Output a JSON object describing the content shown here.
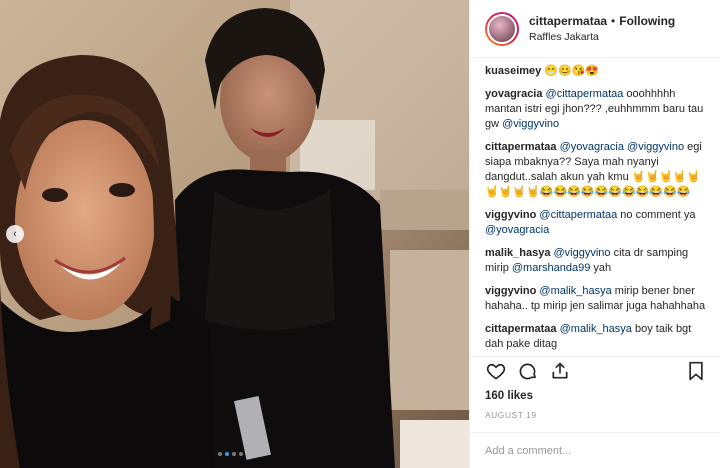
{
  "header": {
    "username": "cittapermataa",
    "separator": "•",
    "follow_status": "Following",
    "location": "Raffles Jakarta"
  },
  "comments": [
    {
      "user": "kuaseimey",
      "parts": [
        {
          "t": "text",
          "v": " 😁😊😘😍"
        }
      ]
    },
    {
      "user": "yovagracia",
      "parts": [
        {
          "t": "mention",
          "v": "@cittapermataa"
        },
        {
          "t": "text",
          "v": " ooohhhhh mantan istri egi jhon??? ,euhhmmm baru tau gw "
        },
        {
          "t": "mention",
          "v": "@viggyvino"
        }
      ]
    },
    {
      "user": "cittapermataa",
      "parts": [
        {
          "t": "mention",
          "v": "@yovagracia"
        },
        {
          "t": "text",
          "v": " "
        },
        {
          "t": "mention",
          "v": "@viggyvino"
        },
        {
          "t": "text",
          "v": " egi siapa mbaknya?? Saya mah nyanyi dangdut..salah akun yah kmu 🤘🤘🤘🤘🤘🤘🤘🤘🤘😂😂😂😂😂😂😂😂😂😂😂"
        }
      ]
    },
    {
      "user": "viggyvino",
      "parts": [
        {
          "t": "mention",
          "v": "@cittapermataa"
        },
        {
          "t": "text",
          "v": " no comment ya "
        },
        {
          "t": "mention",
          "v": "@yovagracia"
        }
      ]
    },
    {
      "user": "malik_hasya",
      "parts": [
        {
          "t": "mention",
          "v": "@viggyvino"
        },
        {
          "t": "text",
          "v": " cita dr samping mirip "
        },
        {
          "t": "mention",
          "v": "@marshanda99"
        },
        {
          "t": "text",
          "v": " yah"
        }
      ]
    },
    {
      "user": "viggyvino",
      "parts": [
        {
          "t": "mention",
          "v": "@malik_hasya"
        },
        {
          "t": "text",
          "v": " mirip bener bner hahaha.. tp mirip jen salimar juga hahahhaha"
        }
      ]
    },
    {
      "user": "cittapermataa",
      "parts": [
        {
          "t": "mention",
          "v": "@malik_hasya"
        },
        {
          "t": "text",
          "v": " boy taik bgt dah pake ditag"
        }
      ]
    }
  ],
  "actions": {
    "like_icon": "heart-icon",
    "comment_icon": "comment-icon",
    "share_icon": "share-icon",
    "save_icon": "bookmark-icon"
  },
  "likes": "160 likes",
  "date": "AUGUST 19",
  "add_comment": {
    "placeholder": "Add a comment...",
    "value": ""
  },
  "carousel": {
    "prev_icon": "chevron-left-icon",
    "count": 4,
    "active": 1
  }
}
